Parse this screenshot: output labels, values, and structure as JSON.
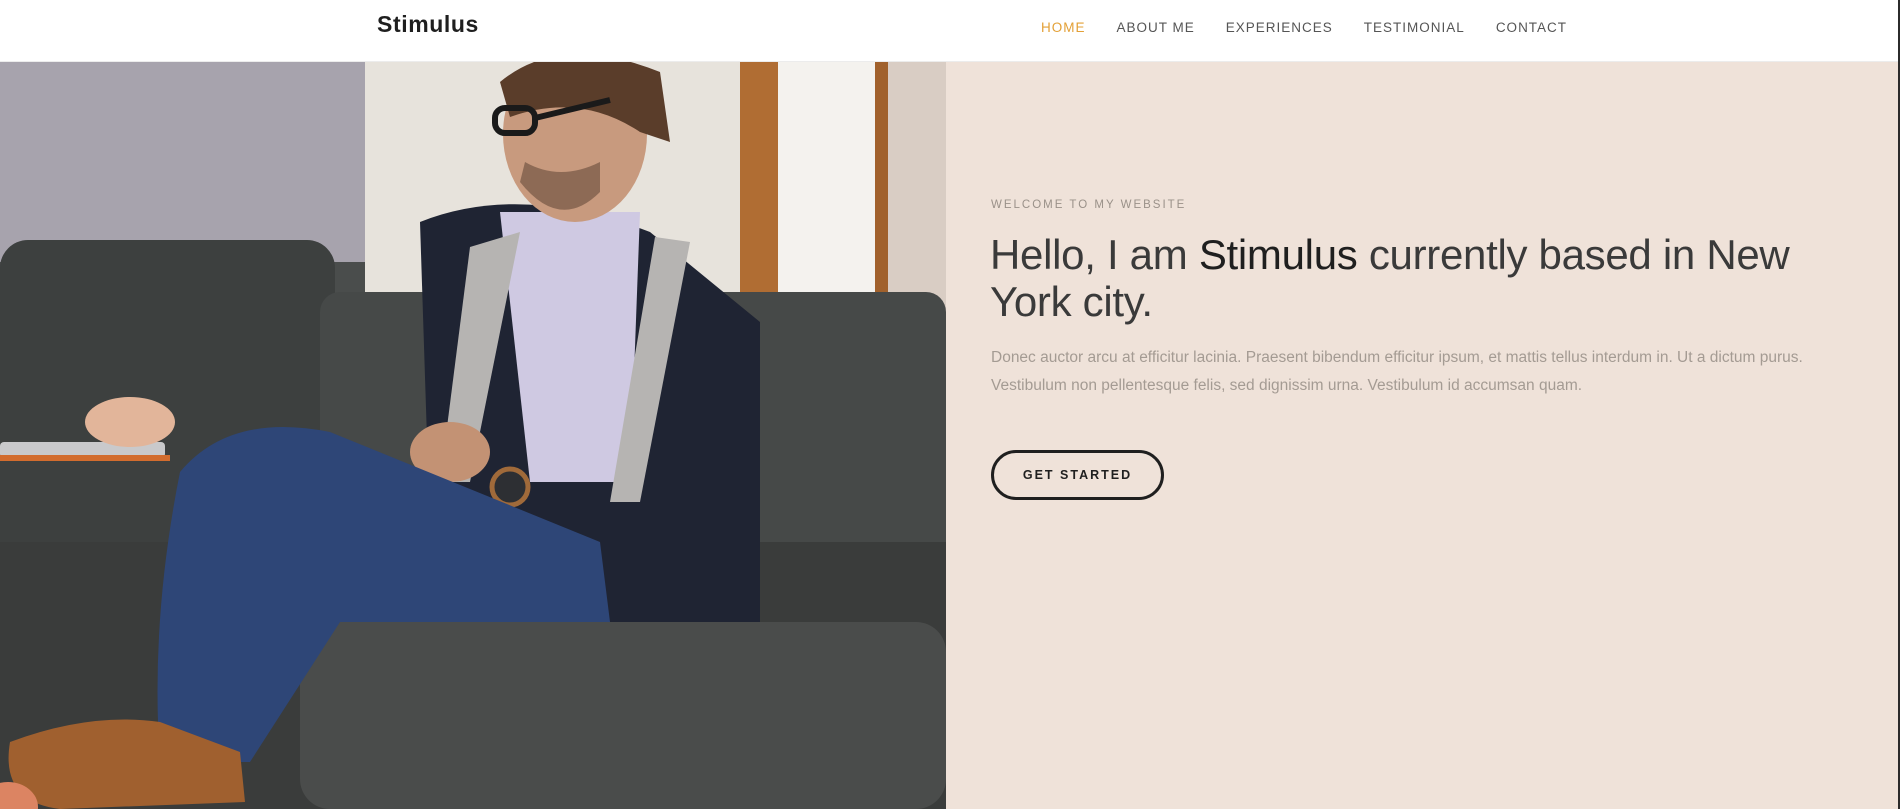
{
  "header": {
    "brand": "Stimulus",
    "nav": [
      {
        "label": "HOME",
        "active": true
      },
      {
        "label": "ABOUT ME",
        "active": false
      },
      {
        "label": "EXPERIENCES",
        "active": false
      },
      {
        "label": "TESTIMONIAL",
        "active": false
      },
      {
        "label": "CONTACT",
        "active": false
      }
    ]
  },
  "hero": {
    "eyebrow": "WELCOME TO MY WEBSITE",
    "headline_pre": "Hello, I am ",
    "headline_name": "Stimulus",
    "headline_post": " currently based in New York city.",
    "intro": "Donec auctor arcu at efficitur lacinia. Praesent bibendum efficitur ipsum, et mattis tellus interdum in. Ut a dictum purus. Vestibulum non pellentesque felis, sed dignissim urna. Vestibulum id accumsan quam.",
    "cta_label": "GET STARTED"
  },
  "colors": {
    "accent": "#e3a036",
    "panel_background": "#efe2d9",
    "text_dark": "#1f1f1f",
    "text_muted": "#a49b93"
  }
}
